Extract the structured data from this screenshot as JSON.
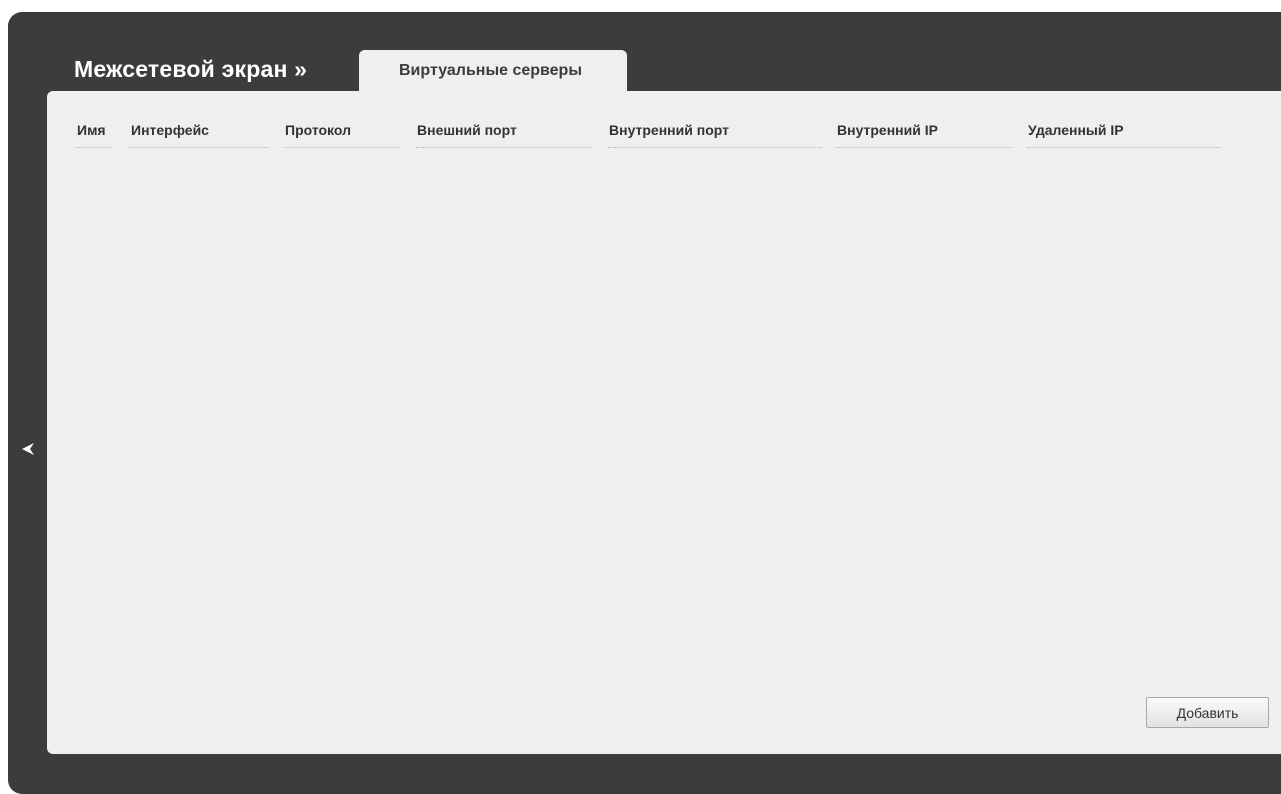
{
  "header": {
    "title": "Межсетевой экран »",
    "active_tab": "Виртуальные серверы"
  },
  "table": {
    "columns": [
      "Имя",
      "Интерфейс",
      "Протокол",
      "Внешний порт",
      "Внутренний порт",
      "Внутренний IP",
      "Удаленный IP"
    ],
    "rows": []
  },
  "actions": {
    "add_label": "Добавить"
  },
  "icons": {
    "back": "chevron-left-icon"
  },
  "colors": {
    "frame": "#3c3c3c",
    "panel": "#efefef",
    "header_text": "#333333"
  }
}
